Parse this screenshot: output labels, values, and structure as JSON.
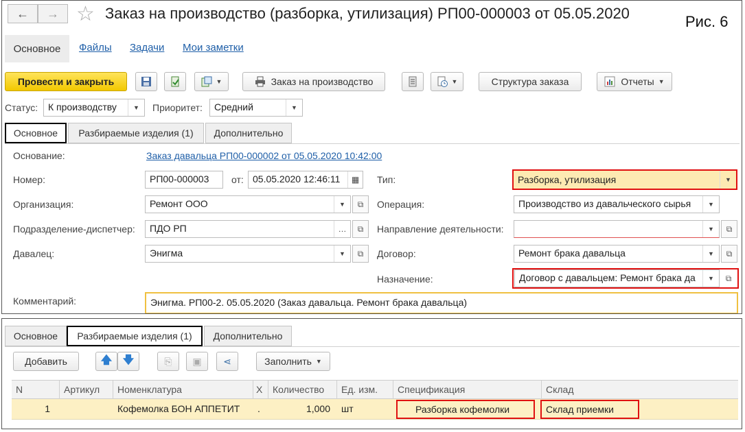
{
  "window": {
    "title": "Заказ на производство (разборка, утилизация) РП00-000003 от 05.05.2020",
    "figure_label": "Рис. 6"
  },
  "nav": {
    "back": "←",
    "forward": "→",
    "star": "☆",
    "items": [
      "Основное",
      "Файлы",
      "Задачи",
      "Мои заметки"
    ]
  },
  "toolbar": {
    "post_close": "Провести и закрыть",
    "production_order": "Заказ на производство",
    "order_structure": "Структура заказа",
    "reports": "Отчеты"
  },
  "status": {
    "label": "Статус:",
    "value": "К производству",
    "priority_label": "Приоритет:",
    "priority_value": "Средний"
  },
  "tabs": [
    "Основное",
    "Разбираемые изделия (1)",
    "Дополнительно"
  ],
  "form": {
    "basis_label": "Основание:",
    "basis_link": "Заказ давальца РП00-000002 от 05.05.2020 10:42:00",
    "number_label": "Номер:",
    "number_value": "РП00-000003",
    "date_label": "от:",
    "date_value": "05.05.2020 12:46:11",
    "org_label": "Организация:",
    "org_value": "Ремонт ООО",
    "dept_label": "Подразделение-диспетчер:",
    "dept_value": "ПДО РП",
    "client_label": "Давалец:",
    "client_value": "Энигма",
    "type_label": "Тип:",
    "type_value": "Разборка, утилизация",
    "operation_label": "Операция:",
    "operation_value": "Производство из давальческого сырья",
    "direction_label": "Направление деятельности:",
    "direction_value": "",
    "contract_label": "Договор:",
    "contract_value": "Ремонт брака давальца",
    "purpose_label": "Назначение:",
    "purpose_value": "Договор с давальцем: Ремонт брака да",
    "comment_label": "Комментарий:",
    "comment_value": "Энигма. РП00-2. 05.05.2020 (Заказ давальца. Ремонт брака давальца)"
  },
  "lower": {
    "tabs": [
      "Основное",
      "Разбираемые изделия (1)",
      "Дополнительно"
    ],
    "add_button": "Добавить",
    "fill_button": "Заполнить",
    "columns": [
      "N",
      "Артикул",
      "Номенклатура",
      "Х",
      "Количество",
      "Ед. изм.",
      "Спецификация",
      "Склад"
    ],
    "rows": [
      {
        "n": "1",
        "article": "",
        "item": "Кофемолка БОН АППЕТИТ",
        "x": ".",
        "qty": "1,000",
        "unit": "шт",
        "spec": "Разборка кофемолки",
        "warehouse": "Склад приемки"
      }
    ]
  },
  "colors": {
    "primary_button": "#f5cf00",
    "highlight_red": "#e01010",
    "row_highlight": "#fdf0c4",
    "link": "#1f5fa8"
  }
}
